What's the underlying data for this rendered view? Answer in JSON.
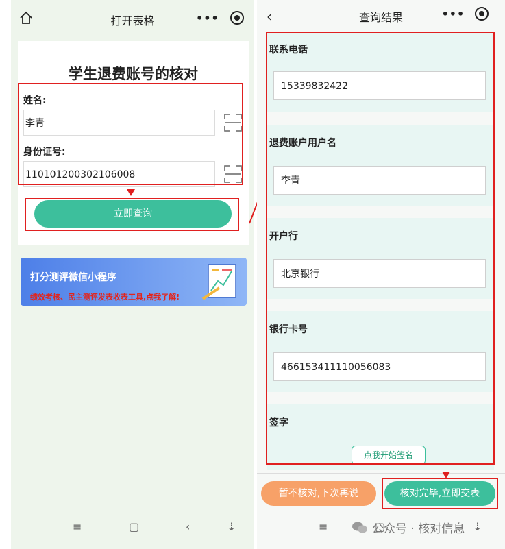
{
  "left": {
    "title": "打开表格",
    "form_title": "学生退费账号的核对",
    "name_label": "姓名:",
    "name_value": "李青",
    "id_label": "身份证号:",
    "id_value": "110101200302106008",
    "query_button": "立即查询",
    "banner_title": "打分测评微信小程序",
    "banner_subtitle": "绩效考核、民主测评发表收表工具,点我了解!",
    "nav": [
      "≡",
      "▢",
      "‹",
      "⇣"
    ]
  },
  "right": {
    "title": "查询结果",
    "fields": [
      {
        "label": "联系电话",
        "value": "15339832422"
      },
      {
        "label": "退费账户用户名",
        "value": "李青"
      },
      {
        "label": "开户行",
        "value": "北京银行"
      },
      {
        "label": "银行卡号",
        "value": "466153411110056083"
      }
    ],
    "sign_label": "签字",
    "sign_button": "点我开始签名",
    "later_button": "暂不核对,下次再说",
    "submit_button": "核对完毕,立即交表",
    "nav": [
      "≡",
      "▢",
      "‹",
      "⇣"
    ],
    "watermark": "公众号 · 核对信息"
  },
  "colors": {
    "accent_green": "#3dbf9c",
    "highlight_red": "#e02020",
    "button_orange": "#f7a168"
  }
}
